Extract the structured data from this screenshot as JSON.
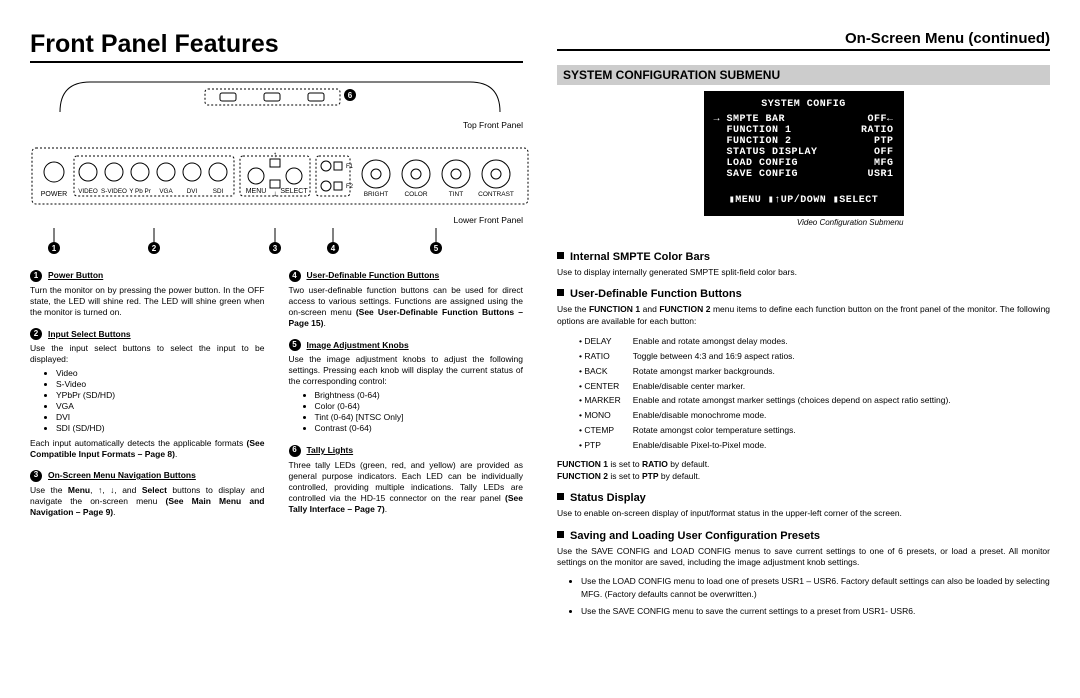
{
  "left": {
    "title": "Front Panel Features",
    "topLabel": "Top Front Panel",
    "bottomLabel": "Lower Front Panel",
    "topCallout": "6",
    "callouts": [
      "1",
      "2",
      "3",
      "4",
      "5"
    ],
    "panelLabels": {
      "power": "POWER",
      "video": "VIDEO",
      "svideo": "S-VIDEO",
      "ypbpr": "Y Pb Pr",
      "vga": "VGA",
      "dvi": "DVI",
      "sdi": "SDI",
      "menu": "MENU",
      "select": "SELECT",
      "f1": "F1",
      "f2": "F2",
      "bright": "BRIGHT",
      "color": "COLOR",
      "tint": "TINT",
      "contrast": "CONTRAST"
    },
    "defs": [
      {
        "n": "1",
        "t": "Power Button",
        "d": "Turn the monitor on by pressing the power button. In the OFF state, the LED will shine red. The LED will shine green when the monitor is turned on."
      },
      {
        "n": "2",
        "t": "Input Select Buttons",
        "d": "Use the input select buttons to select the input to be displayed:",
        "list": [
          "Video",
          "S-Video",
          "YPbPr (SD/HD)",
          "VGA",
          "DVI",
          "SDI (SD/HD)"
        ],
        "after": "Each input automatically detects the applicable formats <b>(See Compatible Input Formats – Page 8)</b>."
      },
      {
        "n": "3",
        "t": "On-Screen Menu Navigation Buttons",
        "d": "Use the <b>Menu</b>, ↑, ↓, and <b>Select</b> buttons to display and navigate the on-screen menu <b>(See Main Menu and Navigation – Page 9)</b>."
      },
      {
        "n": "4",
        "t": "User-Definable Function Buttons",
        "d": "Two user-definable function buttons can be used for direct access to various settings. Functions are assigned using the on-screen menu <b>(See User-Definable Function Buttons – Page 15)</b>."
      },
      {
        "n": "5",
        "t": "Image Adjustment Knobs",
        "d": "Use the image adjustment knobs to adjust the following settings. Pressing each knob will display the current status of the corresponding control:",
        "list": [
          "Brightness (0-64)",
          "Color (0-64)",
          "Tint (0-64) [NTSC Only]",
          "Contrast (0-64)"
        ]
      },
      {
        "n": "6",
        "t": "Tally Lights",
        "d": "Three tally LEDs (green, red, and yellow) are provided as general purpose indicators. Each LED can be individually controlled, providing multiple indications. Tally LEDs are controlled via the HD-15 connector on the rear panel <b>(See Tally Interface – Page 7)</b>."
      }
    ]
  },
  "right": {
    "title": "On-Screen Menu (continued)",
    "submenu": "SYSTEM CONFIGURATION SUBMENU",
    "osd": {
      "header": "SYSTEM CONFIG",
      "rows": [
        [
          "→ SMPTE BAR",
          "OFF←"
        ],
        [
          "  FUNCTION 1",
          "RATIO"
        ],
        [
          "  FUNCTION 2",
          "PTP"
        ],
        [
          "  STATUS DISPLAY",
          "OFF"
        ],
        [
          "  LOAD CONFIG",
          "MFG"
        ],
        [
          "  SAVE CONFIG",
          "USR1"
        ]
      ],
      "footer": "▮MENU ▮↑UP/DOWN ▮SELECT"
    },
    "caption": "Video Configuration Submenu",
    "sections": [
      {
        "t": "Internal SMPTE Color Bars",
        "body": "Use to display internally generated SMPTE split-field color bars."
      },
      {
        "t": "User-Definable Function Buttons",
        "body": "Use the <b>FUNCTION 1</b> and <b>FUNCTION 2</b> menu items to define each function button on the front panel of the monitor. The following options are available for each button:",
        "opts": [
          [
            "DELAY",
            "Enable and rotate amongst delay modes."
          ],
          [
            "RATIO",
            "Toggle between 4:3 and 16:9 aspect ratios."
          ],
          [
            "BACK",
            "Rotate amongst marker backgrounds."
          ],
          [
            "CENTER",
            "Enable/disable center marker."
          ],
          [
            "MARKER",
            "Enable and rotate amongst marker settings (choices depend on aspect ratio setting)."
          ],
          [
            "MONO",
            "Enable/disable monochrome mode."
          ],
          [
            "CTEMP",
            "Rotate amongst color temperature settings."
          ],
          [
            "PTP",
            "Enable/disable Pixel-to-Pixel mode."
          ]
        ],
        "after": "<b>FUNCTION 1</b> is set to <b>RATIO</b> by default.<br><b>FUNCTION 2</b> is set to <b>PTP</b> by default."
      },
      {
        "t": "Status Display",
        "body": "Use to enable on-screen display of input/format status in the upper-left corner of the screen."
      },
      {
        "t": "Saving and Loading User Configuration Presets",
        "body": "Use the SAVE CONFIG and LOAD CONFIG menus to save current settings to one of 6 presets, or load a preset. All monitor settings on the monitor are saved, including the image adjustment knob settings.",
        "bullets": [
          "Use the LOAD CONFIG menu to load one of presets USR1 – USR6. Factory default settings can also be loaded by selecting MFG. (Factory defaults cannot be overwritten.)",
          "Use the SAVE CONFIG menu to save the current settings to a preset from USR1- USR6."
        ]
      }
    ]
  }
}
